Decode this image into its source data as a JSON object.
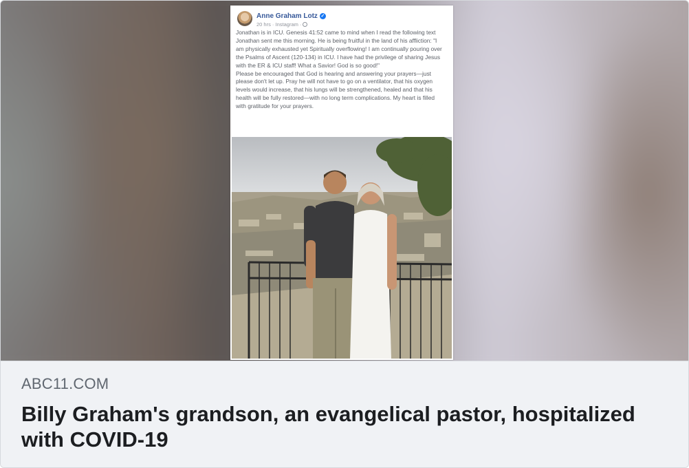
{
  "post": {
    "author": "Anne Graham Lotz",
    "meta": "20 hrs · Instagram ·",
    "paragraphs": [
      "Jonathan is in ICU. Genesis 41:52 came to mind when I read the following text Jonathan sent me this morning. He is being fruitful in the land of his affliction: \"I am physically exhausted yet Spiritually overflowing! I am continually pouring over the Psalms of Ascent (120-134) in ICU. I have had the privilege of sharing Jesus with the ER & ICU staff! What a Savior! God is so good!\"",
      "Please be encouraged that God is hearing and answering your prayers—just please don't let up. Pray he will not have to go on a ventilator, that his oxygen levels would increase, that his lungs will be strengthened, healed and that his health will be fully restored—with no long term complications. My heart is filled with gratitude for your prayers."
    ],
    "icons": {
      "verified": "verified-badge-icon",
      "audience": "globe-icon"
    },
    "colors": {
      "author": "#365899",
      "verified": "#1877f2"
    }
  },
  "link": {
    "domain": "ABC11.COM",
    "title": "Billy Graham's grandson, an evangelical pastor, hospitalized with COVID-19"
  }
}
